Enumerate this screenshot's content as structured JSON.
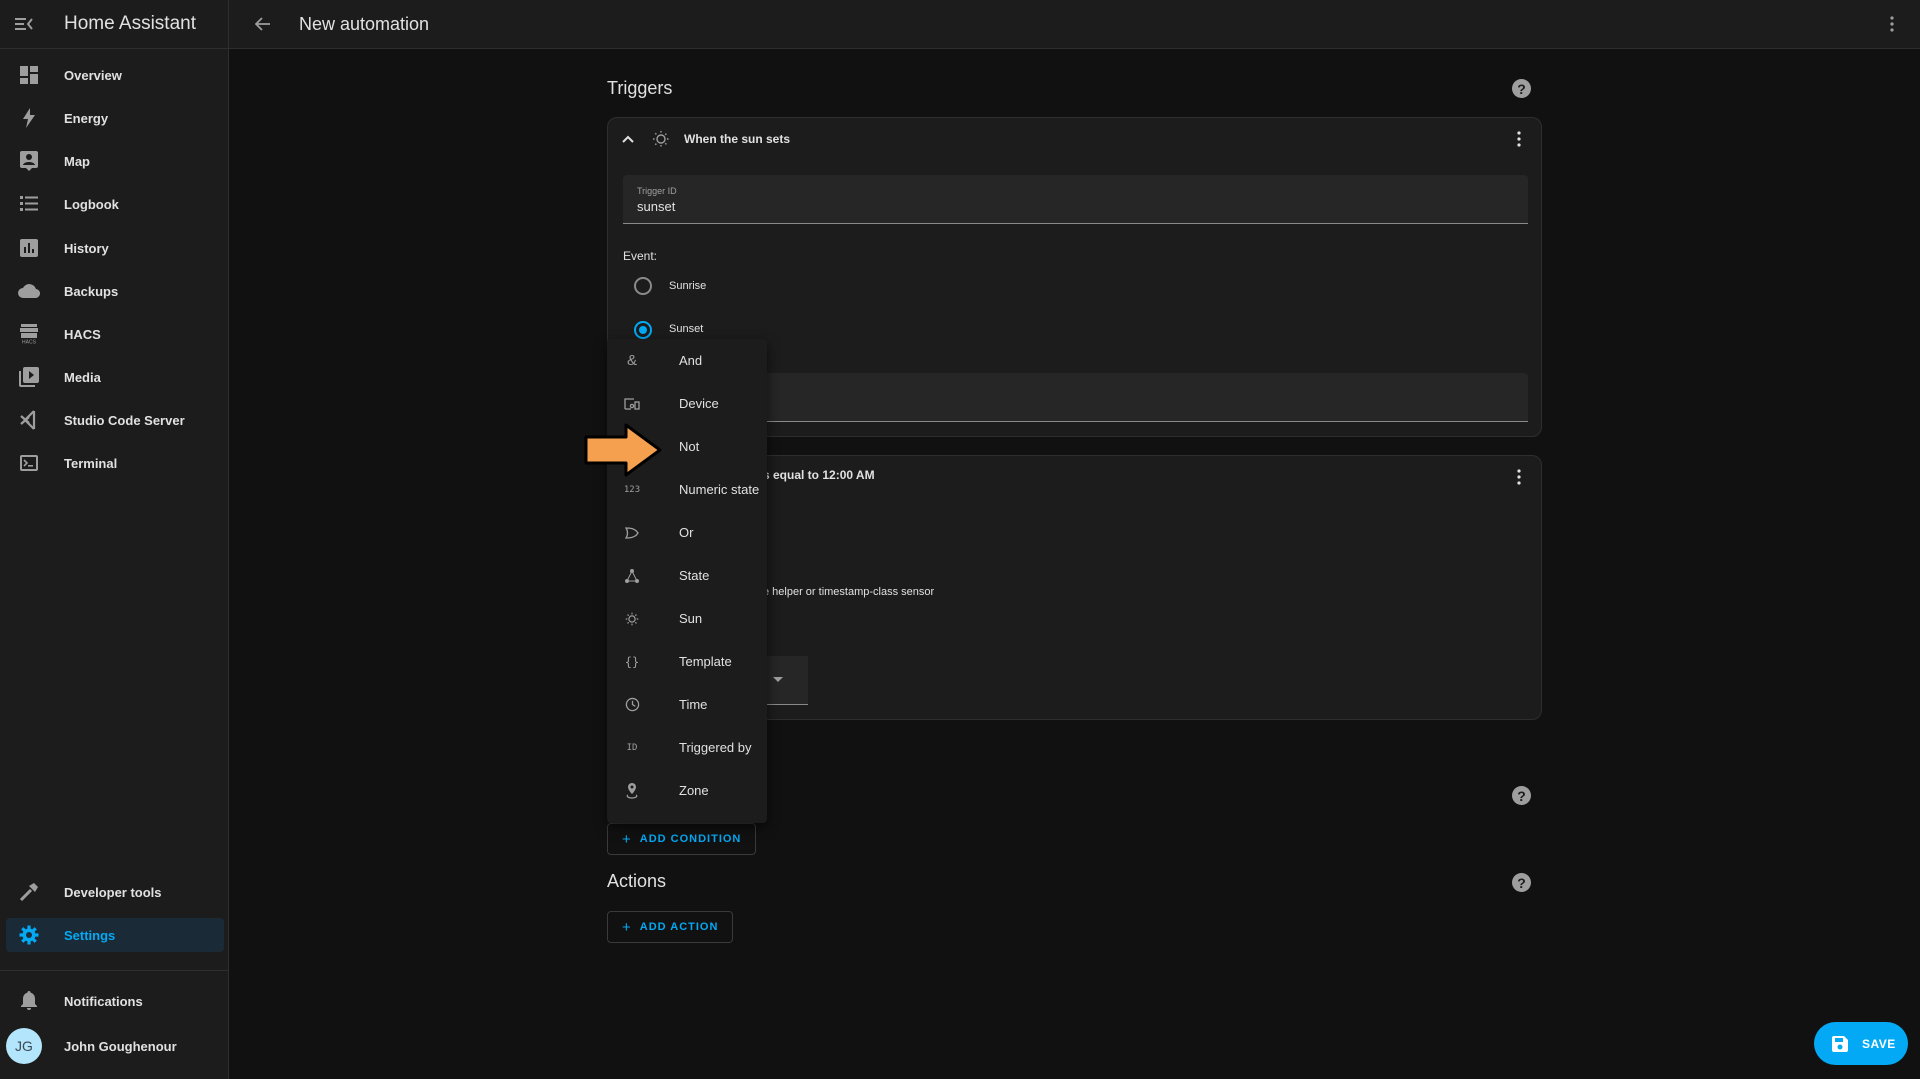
{
  "app": {
    "title": "Home Assistant"
  },
  "header": {
    "title": "New automation",
    "back_icon": "arrow-left-icon",
    "more_icon": "dots-vertical-icon"
  },
  "sidebar": {
    "items": [
      {
        "label": "Overview",
        "icon": "view-dashboard-icon"
      },
      {
        "label": "Energy",
        "icon": "lightning-bolt-icon"
      },
      {
        "label": "Map",
        "icon": "map-account-icon"
      },
      {
        "label": "Logbook",
        "icon": "format-list-bulleted-icon"
      },
      {
        "label": "History",
        "icon": "chart-box-icon"
      },
      {
        "label": "Backups",
        "icon": "cloud-icon"
      },
      {
        "label": "HACS",
        "icon": "hacs-store-icon"
      },
      {
        "label": "Media",
        "icon": "play-box-multiple-icon"
      },
      {
        "label": "Studio Code Server",
        "icon": "vscode-icon"
      },
      {
        "label": "Terminal",
        "icon": "console-icon"
      }
    ],
    "bottom_items": [
      {
        "label": "Developer tools",
        "icon": "hammer-icon"
      },
      {
        "label": "Settings",
        "icon": "cog-icon",
        "active": true
      }
    ],
    "notifications": {
      "label": "Notifications",
      "icon": "bell-icon"
    },
    "user": {
      "initials": "JG",
      "name": "John Goughenour"
    }
  },
  "triggers": {
    "title": "Triggers",
    "card": {
      "title": "When the sun sets",
      "icon": "weather-sunset-icon",
      "trigger_id_label": "Trigger ID",
      "trigger_id_value": "sunset",
      "event_label": "Event:",
      "options": [
        {
          "label": "Sunrise",
          "selected": false
        },
        {
          "label": "Sunset",
          "selected": true
        }
      ]
    }
  },
  "condition_card": {
    "title_partial": "s equal to 12:00 AM",
    "helper_text_partial": "e helper or timestamp-class sensor"
  },
  "condition_menu": {
    "items": [
      {
        "label": "And",
        "icon": "ampersand-icon",
        "glyph": "&"
      },
      {
        "label": "Device",
        "icon": "devices-icon",
        "glyph": ""
      },
      {
        "label": "Not",
        "icon": "not-icon",
        "glyph": ""
      },
      {
        "label": "Numeric state",
        "icon": "numeric-icon",
        "glyph": "123"
      },
      {
        "label": "Or",
        "icon": "gate-or-icon",
        "glyph": ""
      },
      {
        "label": "State",
        "icon": "state-machine-icon",
        "glyph": ""
      },
      {
        "label": "Sun",
        "icon": "weather-sunny-icon",
        "glyph": ""
      },
      {
        "label": "Template",
        "icon": "code-braces-icon",
        "glyph": "{}"
      },
      {
        "label": "Time",
        "icon": "clock-outline-icon",
        "glyph": ""
      },
      {
        "label": "Triggered by",
        "icon": "identifier-icon",
        "glyph": "ID"
      },
      {
        "label": "Zone",
        "icon": "map-marker-radius-icon",
        "glyph": ""
      }
    ],
    "highlight": "Not"
  },
  "conditions": {
    "add_label": "ADD CONDITION"
  },
  "actions": {
    "title": "Actions",
    "add_label": "ADD ACTION"
  },
  "save": {
    "label": "SAVE",
    "icon": "content-save-icon"
  },
  "colors": {
    "accent": "#03a9f4",
    "arrow": "#f4a04e",
    "background": "#111111",
    "card": "#1c1c1c"
  }
}
